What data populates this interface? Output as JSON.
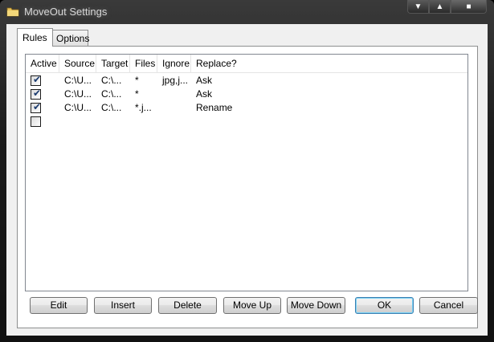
{
  "window": {
    "title": "MoveOut Settings",
    "min_glyph": "▼",
    "max_glyph": "▲",
    "close_glyph": "■"
  },
  "tabs": [
    {
      "label": "Rules"
    },
    {
      "label": "Options"
    }
  ],
  "table": {
    "columns": [
      "Active",
      "Source",
      "Target",
      "Files",
      "Ignore",
      "Replace?"
    ],
    "rows": [
      {
        "active": true,
        "source": "C:\\U...",
        "target": "C:\\...",
        "files": "*",
        "ignore": "jpg,j...",
        "replace": "Ask"
      },
      {
        "active": true,
        "source": "C:\\U...",
        "target": "C:\\...",
        "files": "*",
        "ignore": "",
        "replace": "Ask"
      },
      {
        "active": true,
        "source": "C:\\U...",
        "target": "C:\\...",
        "files": "*.j...",
        "ignore": "",
        "replace": "Rename"
      },
      {
        "active": false,
        "source": "",
        "target": "",
        "files": "",
        "ignore": "",
        "replace": ""
      }
    ]
  },
  "buttons": {
    "edit": "Edit",
    "insert": "Insert",
    "delete": "Delete",
    "move_up": "Move Up",
    "move_down": "Move Down",
    "ok": "OK",
    "cancel": "Cancel"
  },
  "checkmark": "✔"
}
